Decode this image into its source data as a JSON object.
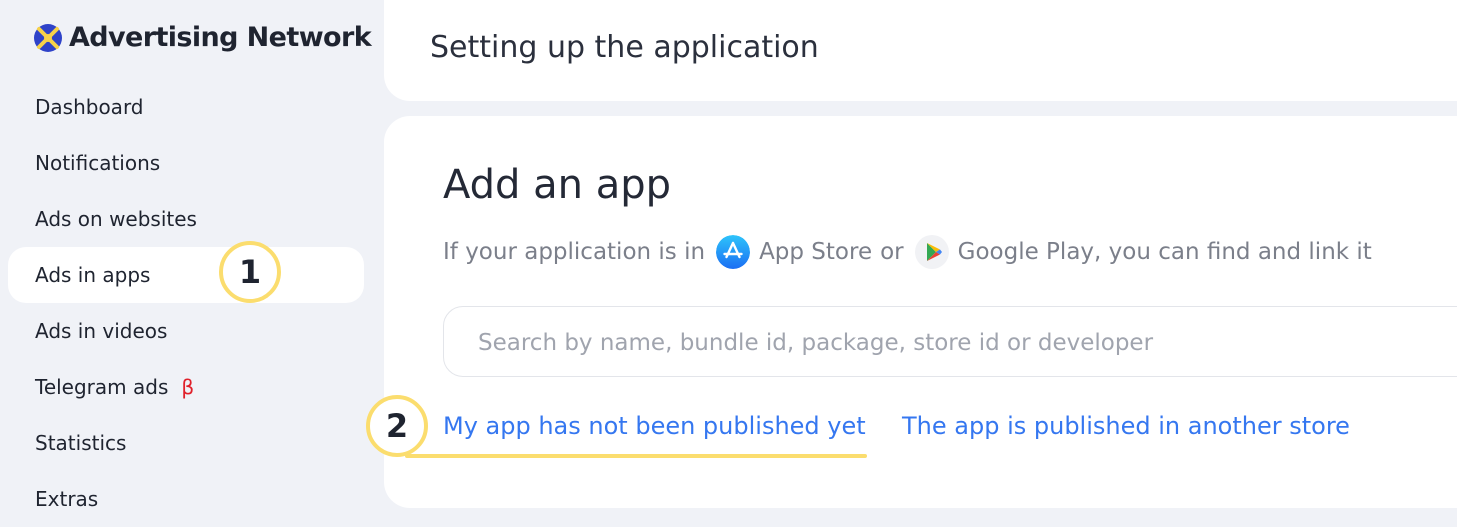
{
  "app": {
    "name": "Advertising Network",
    "logo_icon": "advertising-network-logo-icon"
  },
  "sidebar": {
    "items": [
      {
        "label": "Dashboard"
      },
      {
        "label": "Notifications"
      },
      {
        "label": "Ads on websites"
      },
      {
        "label": "Ads in apps",
        "active": true
      },
      {
        "label": "Ads in videos"
      },
      {
        "label": "Telegram ads",
        "badge": "β"
      },
      {
        "label": "Statistics"
      },
      {
        "label": "Extras"
      }
    ]
  },
  "header": {
    "title": "Setting up the application"
  },
  "main": {
    "title": "Add an app",
    "subtitle": {
      "prefix": "If your application is in",
      "store1": "App Store",
      "connector": "or",
      "store2": "Google Play",
      "suffix": ", you can find and link it",
      "store1_icon": "app-store-icon",
      "store2_icon": "google-play-icon"
    },
    "search": {
      "placeholder": "Search by name, bundle id, package, store id or developer",
      "value": ""
    },
    "links": {
      "not_published": "My app has not been published yet",
      "other_store": "The app is published in another store"
    }
  },
  "callouts": {
    "first": "1",
    "second": "2"
  },
  "colors": {
    "accent_link": "#3577f0",
    "callout_ring": "#fbdd6e",
    "beta_badge": "#e0202a",
    "app_background": "#f0f2f7"
  }
}
